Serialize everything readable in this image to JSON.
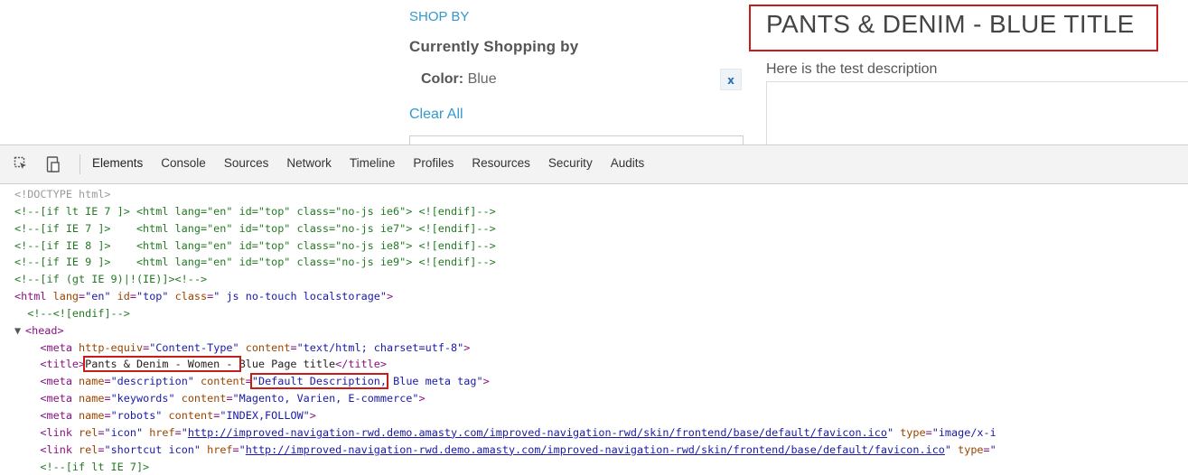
{
  "page": {
    "shop_by": "SHOP BY",
    "currently_shopping": "Currently Shopping by",
    "filter_label": "Color:",
    "filter_value": "Blue",
    "remove_filter": "x",
    "clear_all": "Clear All",
    "title": "PANTS & DENIM - BLUE TITLE",
    "description": "Here is the test description"
  },
  "devtools": {
    "tabs": [
      "Elements",
      "Console",
      "Sources",
      "Network",
      "Timeline",
      "Profiles",
      "Resources",
      "Security",
      "Audits"
    ],
    "active_tab": "Elements",
    "lines": [
      {
        "indent": 0,
        "parts": [
          [
            "doctype",
            "<!DOCTYPE html>"
          ]
        ]
      },
      {
        "indent": 0,
        "parts": [
          [
            "cm",
            "<!--[if lt IE 7 ]> <html lang=\"en\" id=\"top\" class=\"no-js ie6\"> <![endif]-->"
          ]
        ]
      },
      {
        "indent": 0,
        "parts": [
          [
            "cm",
            "<!--[if IE 7 ]>    <html lang=\"en\" id=\"top\" class=\"no-js ie7\"> <![endif]-->"
          ]
        ]
      },
      {
        "indent": 0,
        "parts": [
          [
            "cm",
            "<!--[if IE 8 ]>    <html lang=\"en\" id=\"top\" class=\"no-js ie8\"> <![endif]-->"
          ]
        ]
      },
      {
        "indent": 0,
        "parts": [
          [
            "cm",
            "<!--[if IE 9 ]>    <html lang=\"en\" id=\"top\" class=\"no-js ie9\"> <![endif]-->"
          ]
        ]
      },
      {
        "indent": 0,
        "parts": [
          [
            "cm",
            "<!--[if (gt IE 9)|!(IE)]><!-->"
          ]
        ]
      },
      {
        "indent": 0,
        "parts": [
          [
            "tag",
            "<html "
          ],
          [
            "an",
            "lang"
          ],
          [
            "tag",
            "="
          ],
          [
            "av",
            "\"en\""
          ],
          [
            "an",
            " id"
          ],
          [
            "tag",
            "="
          ],
          [
            "av",
            "\"top\""
          ],
          [
            "an",
            " class"
          ],
          [
            "tag",
            "="
          ],
          [
            "av",
            "\" js no-touch localstorage\""
          ],
          [
            "tag",
            ">"
          ]
        ]
      },
      {
        "indent": 1,
        "parts": [
          [
            "cm",
            "<!--<![endif]-->"
          ]
        ]
      },
      {
        "indent": 0,
        "tri": "▼",
        "parts": [
          [
            "tag",
            "<head>"
          ]
        ]
      },
      {
        "indent": 2,
        "parts": [
          [
            "tag",
            "<meta "
          ],
          [
            "an",
            "http-equiv"
          ],
          [
            "tag",
            "="
          ],
          [
            "av",
            "\"Content-Type\""
          ],
          [
            "an",
            " content"
          ],
          [
            "tag",
            "="
          ],
          [
            "av",
            "\"text/html; charset=utf-8\""
          ],
          [
            "tag",
            ">"
          ]
        ]
      },
      {
        "indent": 2,
        "parts": [
          [
            "tag",
            "<title>"
          ],
          [
            "hl",
            "Pants & Denim - Women - "
          ],
          [
            "tx",
            "Blue Page title"
          ],
          [
            "tag",
            "</title>"
          ]
        ]
      },
      {
        "indent": 2,
        "parts": [
          [
            "tag",
            "<meta "
          ],
          [
            "an",
            "name"
          ],
          [
            "tag",
            "="
          ],
          [
            "av",
            "\"description\""
          ],
          [
            "an",
            " content"
          ],
          [
            "tag",
            "="
          ],
          [
            "hlav",
            "\"Default Description,"
          ],
          [
            "av",
            " Blue meta tag\""
          ],
          [
            "tag",
            ">"
          ]
        ]
      },
      {
        "indent": 2,
        "parts": [
          [
            "tag",
            "<meta "
          ],
          [
            "an",
            "name"
          ],
          [
            "tag",
            "="
          ],
          [
            "av",
            "\"keywords\""
          ],
          [
            "an",
            " content"
          ],
          [
            "tag",
            "="
          ],
          [
            "av",
            "\"Magento, Varien, E-commerce\""
          ],
          [
            "tag",
            ">"
          ]
        ]
      },
      {
        "indent": 2,
        "parts": [
          [
            "tag",
            "<meta "
          ],
          [
            "an",
            "name"
          ],
          [
            "tag",
            "="
          ],
          [
            "av",
            "\"robots\""
          ],
          [
            "an",
            " content"
          ],
          [
            "tag",
            "="
          ],
          [
            "av",
            "\"INDEX,FOLLOW\""
          ],
          [
            "tag",
            ">"
          ]
        ]
      },
      {
        "indent": 2,
        "parts": [
          [
            "tag",
            "<link "
          ],
          [
            "an",
            "rel"
          ],
          [
            "tag",
            "="
          ],
          [
            "av",
            "\"icon\""
          ],
          [
            "an",
            " href"
          ],
          [
            "tag",
            "="
          ],
          [
            "av",
            "\""
          ],
          [
            "lnk",
            "http://improved-navigation-rwd.demo.amasty.com/improved-navigation-rwd/skin/frontend/base/default/favicon.ico"
          ],
          [
            "av",
            "\""
          ],
          [
            "an",
            " type"
          ],
          [
            "tag",
            "="
          ],
          [
            "av",
            "\"image/x-i"
          ]
        ]
      },
      {
        "indent": 2,
        "parts": [
          [
            "tag",
            "<link "
          ],
          [
            "an",
            "rel"
          ],
          [
            "tag",
            "="
          ],
          [
            "av",
            "\"shortcut icon\""
          ],
          [
            "an",
            " href"
          ],
          [
            "tag",
            "="
          ],
          [
            "av",
            "\""
          ],
          [
            "lnk",
            "http://improved-navigation-rwd.demo.amasty.com/improved-navigation-rwd/skin/frontend/base/default/favicon.ico"
          ],
          [
            "av",
            "\""
          ],
          [
            "an",
            " type"
          ],
          [
            "tag",
            "="
          ],
          [
            "av",
            "\""
          ]
        ]
      },
      {
        "indent": 2,
        "parts": [
          [
            "cm",
            "<!--[if lt IE 7]>"
          ]
        ]
      }
    ]
  }
}
